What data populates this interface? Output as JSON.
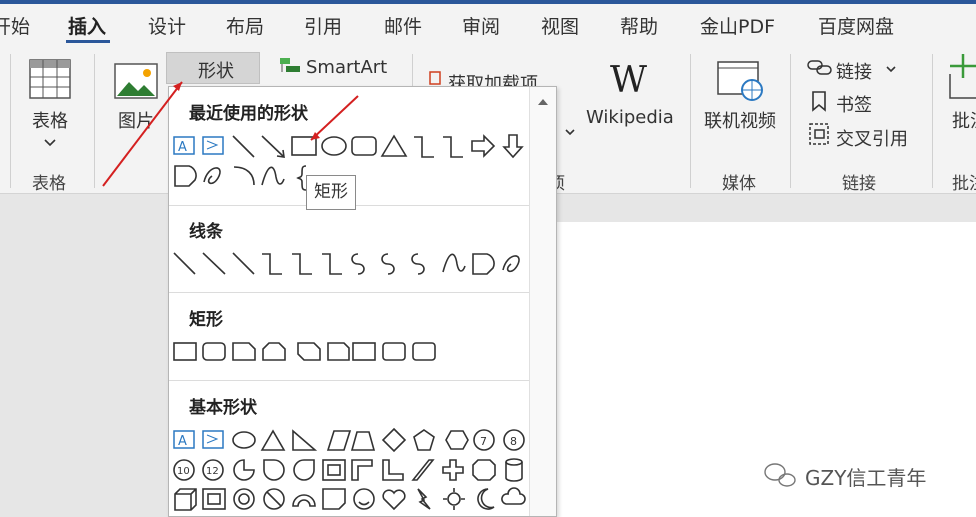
{
  "tabs": [
    {
      "label": "开始"
    },
    {
      "label": "插入"
    },
    {
      "label": "设计"
    },
    {
      "label": "布局"
    },
    {
      "label": "引用"
    },
    {
      "label": "邮件"
    },
    {
      "label": "审阅"
    },
    {
      "label": "视图"
    },
    {
      "label": "帮助"
    },
    {
      "label": "金山PDF"
    },
    {
      "label": "百度网盘"
    }
  ],
  "ribbon": {
    "table_label": "表格",
    "table_group": "表格",
    "picture_label": "图片",
    "shapes_label": "形状",
    "smartart_label": "SmartArt",
    "addins_label": "获取加载项",
    "addins_group": "项",
    "wikipedia_label": "Wikipedia",
    "video_label": "联机视频",
    "media_group": "媒体",
    "link_label": "链接",
    "bookmark_label": "书签",
    "crossref_label": "交叉引用",
    "links_group": "链接",
    "comment_label": "批注",
    "comment_group": "批注"
  },
  "gallery": {
    "recent_title": "最近使用的形状",
    "lines_title": "线条",
    "rect_title": "矩形",
    "basic_title": "基本形状",
    "tooltip": "矩形"
  },
  "watermark": "GZY信工青年",
  "colors": {
    "accent": "#2b579a",
    "arrow": "#d42020"
  }
}
